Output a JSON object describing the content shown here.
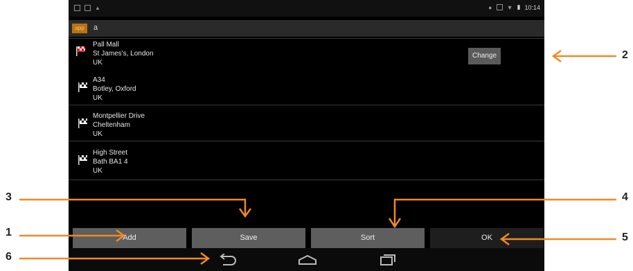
{
  "status_bar": {
    "time": "10:14"
  },
  "header": {
    "title": "a"
  },
  "routes": [
    {
      "lines": [
        "Pall Mall",
        "St James's, London",
        "UK"
      ],
      "flag": "red"
    },
    {
      "lines": [
        "A34",
        "Botley, Oxford",
        "UK"
      ],
      "flag": "white"
    },
    {
      "lines": [
        "Montpellier Drive",
        "Cheltenham",
        "UK"
      ],
      "flag": "white"
    },
    {
      "lines": [
        "High Street",
        "Bath BA1 4",
        "UK"
      ],
      "flag": "white"
    }
  ],
  "change_label": "Change",
  "buttons": {
    "add": "Add",
    "save": "Save",
    "sort": "Sort",
    "ok": "OK"
  },
  "callouts": [
    "1",
    "2",
    "3",
    "4",
    "5",
    "6"
  ],
  "colors": {
    "accent": "#f08a24",
    "button": "#5e5e5e",
    "ok_button": "#1e1e1e"
  }
}
